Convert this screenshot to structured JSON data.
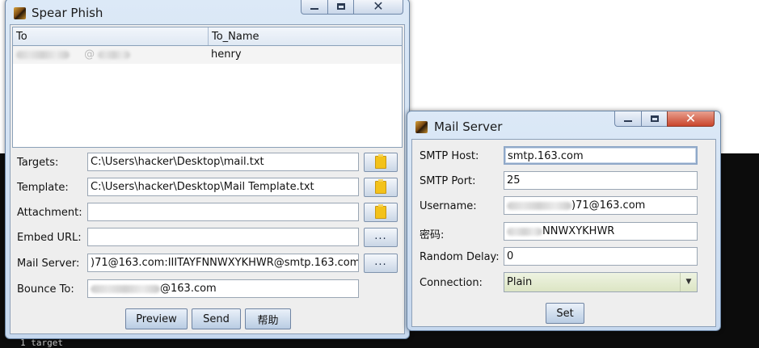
{
  "console": {
    "footer_text": "1 target"
  },
  "spear_window": {
    "title": "Spear Phish",
    "table": {
      "columns": [
        "To",
        "To_Name"
      ],
      "rows": [
        {
          "to_tail": "@",
          "to_name": "henry"
        }
      ]
    },
    "form": {
      "targets_label": "Targets:",
      "targets_value": "C:\\Users\\hacker\\Desktop\\mail.txt",
      "template_label": "Template:",
      "template_value": "C:\\Users\\hacker\\Desktop\\Mail Template.txt",
      "attachment_label": "Attachment:",
      "attachment_value": "",
      "embed_label": "Embed URL:",
      "embed_value": "",
      "mailserver_label": "Mail Server:",
      "mailserver_value": ")71@163.com:IIITAYFNNWXYKHWR@smtp.163.com",
      "bounce_label": "Bounce To:",
      "bounce_value": "@163.com",
      "browse_dots": "..."
    },
    "buttons": {
      "preview": "Preview",
      "send": "Send",
      "help": "帮助"
    }
  },
  "mail_window": {
    "title": "Mail Server",
    "smtp_host_label": "SMTP Host:",
    "smtp_host_value": "smtp.163.com",
    "smtp_port_label": "SMTP Port:",
    "smtp_port_value": "25",
    "username_label": "Username:",
    "username_value": ")71@163.com",
    "password_label": "密码:",
    "password_value": "NNWXYKHWR",
    "random_delay_label": "Random Delay:",
    "random_delay_value": "0",
    "connection_label": "Connection:",
    "connection_value": "Plain",
    "set_button": "Set"
  },
  "colors": {
    "title_gradient_top": "#dce9f7",
    "title_gradient_bottom": "#c6d8ee",
    "close_red": "#c9452c",
    "folder_yellow": "#f3c21a"
  },
  "icons": [
    "app-icon",
    "minimize-icon",
    "maximize-icon",
    "close-icon",
    "folder-icon",
    "chevron-down-icon"
  ]
}
